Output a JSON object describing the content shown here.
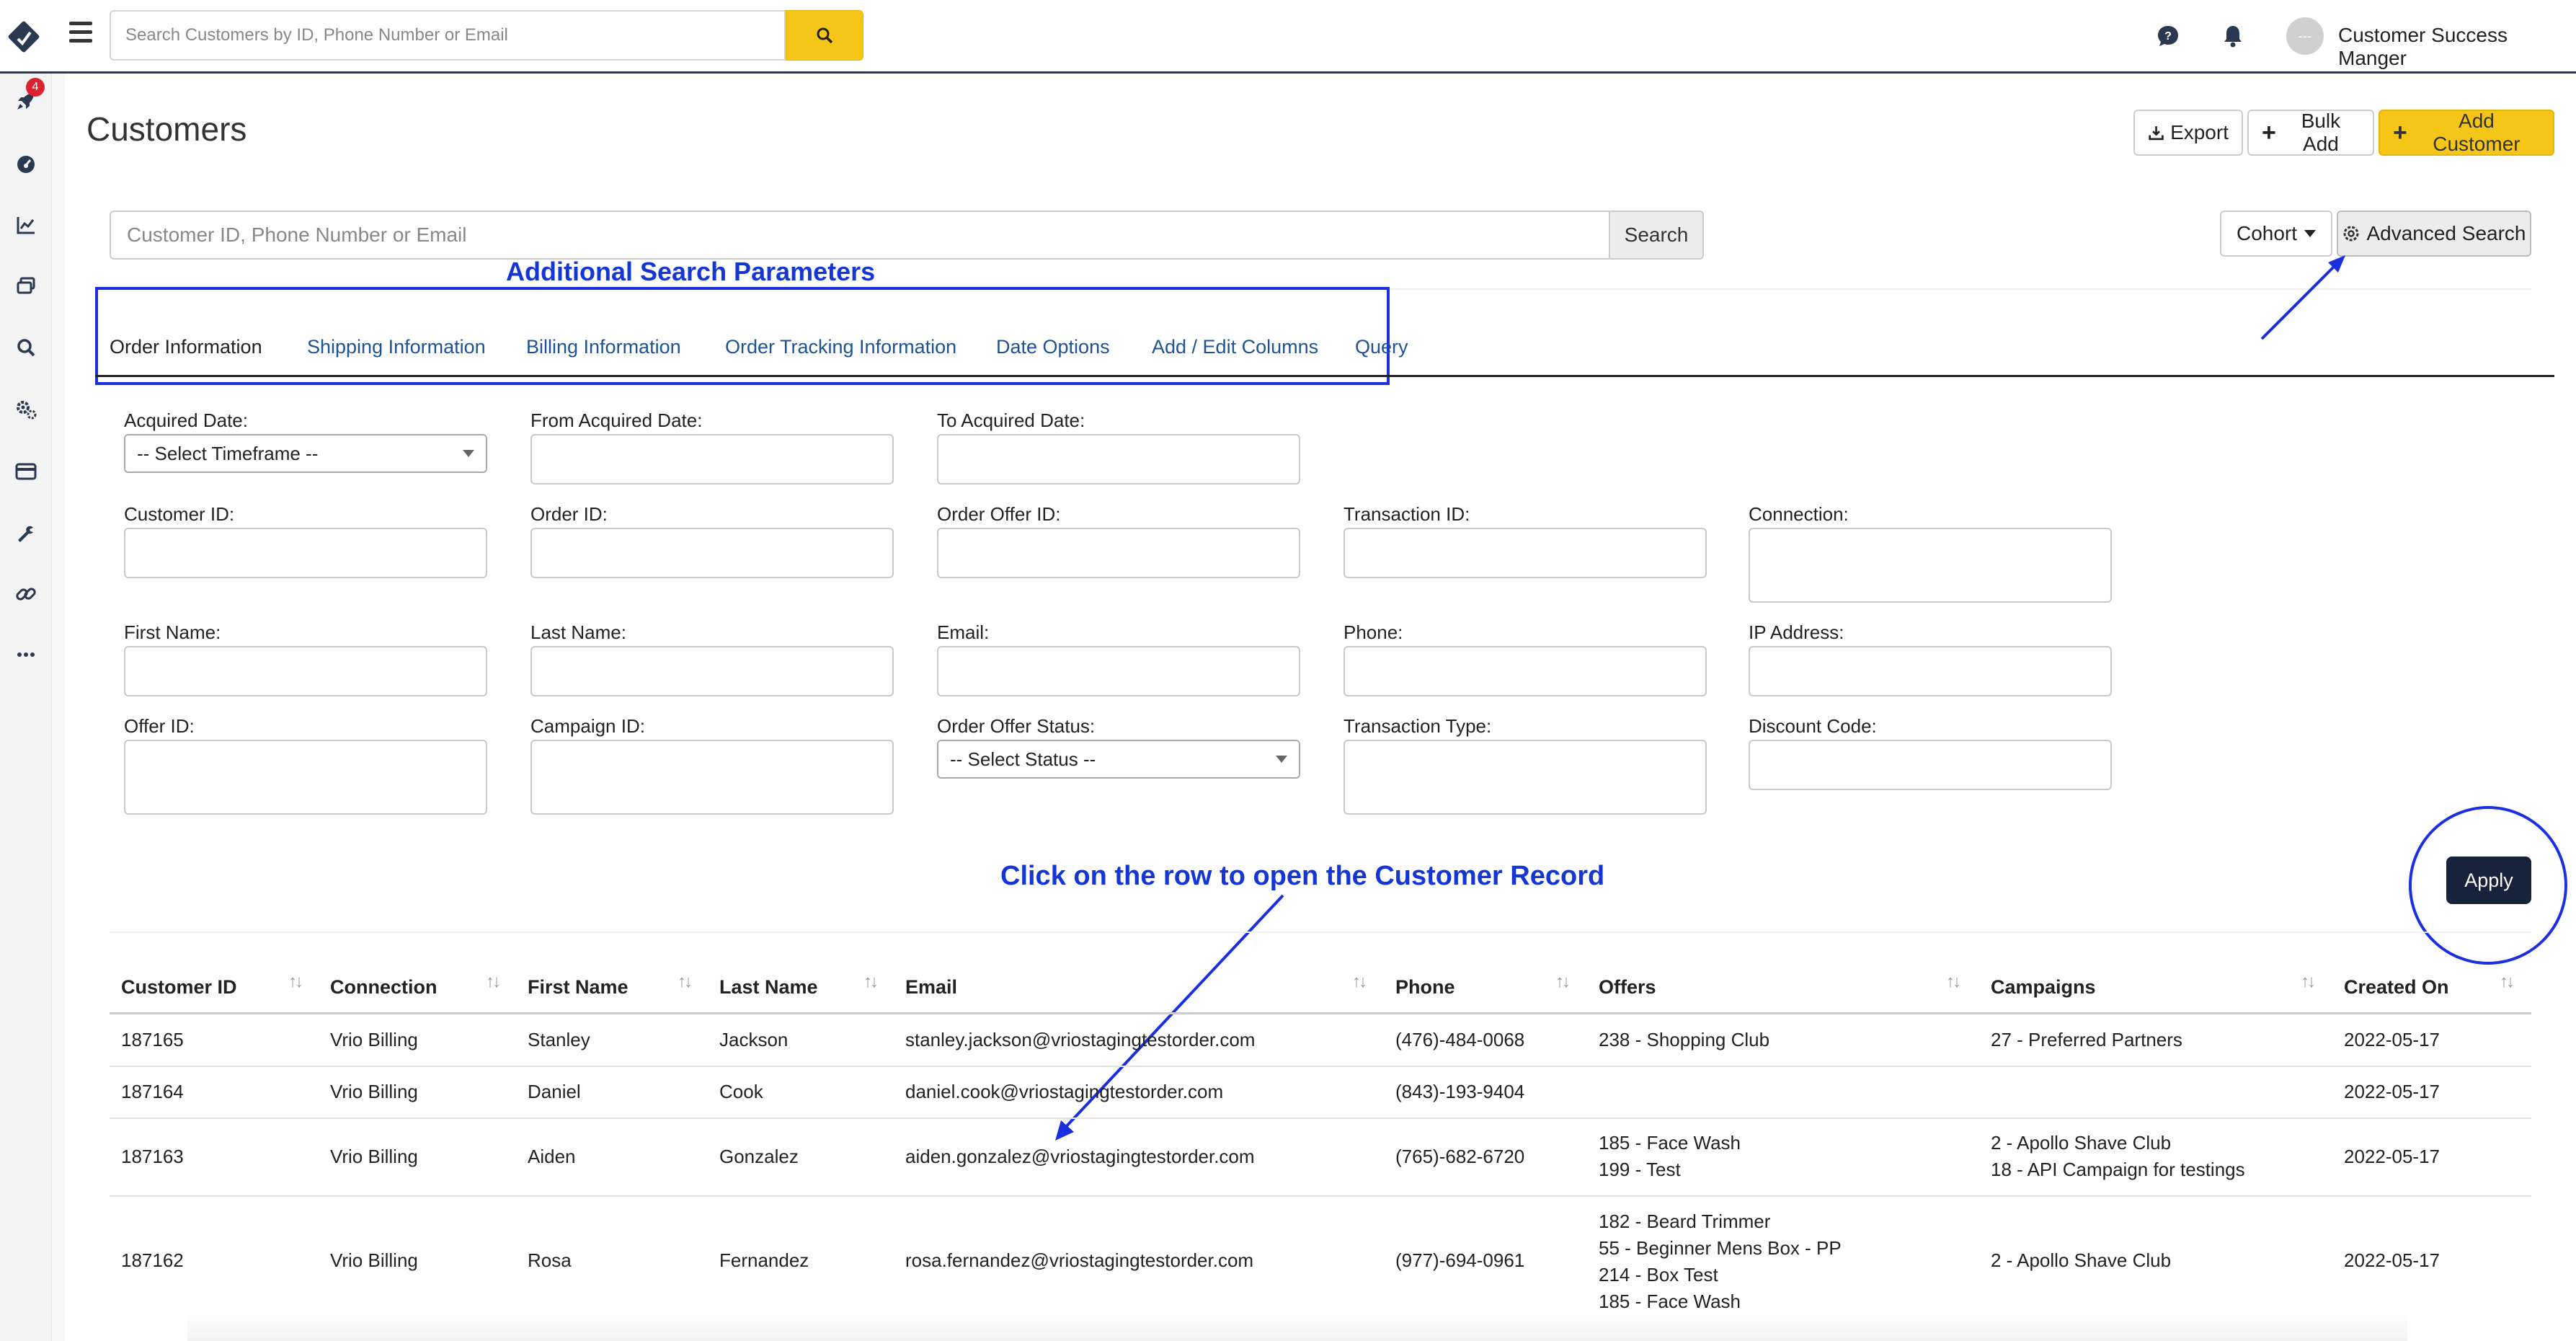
{
  "topbar": {
    "search_placeholder": "Search Customers by ID, Phone Number or Email",
    "user_initials": "---",
    "user_name": "Customer Success Manger"
  },
  "sidebar": {
    "notification_count": "4",
    "icons": [
      "rocket-icon",
      "dashboard-icon",
      "chart-icon",
      "documents-icon",
      "search-icon",
      "settings-icon",
      "billing-icon",
      "wrench-icon",
      "link-icon",
      "more-icon"
    ]
  },
  "page": {
    "title": "Customers",
    "export_label": "Export",
    "bulk_add_label": "Bulk Add",
    "add_customer_label": "Add Customer",
    "search_placeholder": "Customer ID, Phone Number or Email",
    "search_label": "Search",
    "cohort_label": "Cohort",
    "advanced_search_label": "Advanced Search"
  },
  "annotations": {
    "params": "Additional Search Parameters",
    "click_row": "Click on the row to open the Customer Record",
    "color": "#1b2ee0"
  },
  "tabs": [
    {
      "label": "Order Information"
    },
    {
      "label": "Shipping Information"
    },
    {
      "label": "Billing Information"
    },
    {
      "label": "Order Tracking Information"
    },
    {
      "label": "Date Options"
    },
    {
      "label": "Add / Edit Columns"
    },
    {
      "label": "Query"
    }
  ],
  "form": {
    "acquired_date": "Acquired Date:",
    "acquired_date_value": "-- Select Timeframe --",
    "from_acquired_date": "From Acquired Date:",
    "to_acquired_date": "To Acquired Date:",
    "customer_id": "Customer ID:",
    "order_id": "Order ID:",
    "order_offer_id": "Order Offer ID:",
    "transaction_id": "Transaction ID:",
    "connection": "Connection:",
    "first_name": "First Name:",
    "last_name": "Last Name:",
    "email": "Email:",
    "phone": "Phone:",
    "ip_address": "IP Address:",
    "offer_id": "Offer ID:",
    "campaign_id": "Campaign ID:",
    "order_offer_status": "Order Offer Status:",
    "order_offer_status_value": "-- Select Status --",
    "transaction_type": "Transaction Type:",
    "discount_code": "Discount Code:",
    "apply_label": "Apply"
  },
  "table": {
    "headers": [
      "Customer ID",
      "Connection",
      "First Name",
      "Last Name",
      "Email",
      "Phone",
      "Offers",
      "Campaigns",
      "Created On"
    ],
    "rows": [
      {
        "id": "187165",
        "connection": "Vrio Billing",
        "first": "Stanley",
        "last": "Jackson",
        "email": "stanley.jackson@vriostagingtestorder.com",
        "phone": "(476)-484-0068",
        "offers": [
          "238 - Shopping Club"
        ],
        "campaigns": [
          "27 - Preferred Partners"
        ],
        "created": "2022-05-17"
      },
      {
        "id": "187164",
        "connection": "Vrio Billing",
        "first": "Daniel",
        "last": "Cook",
        "email": "daniel.cook@vriostagingtestorder.com",
        "phone": "(843)-193-9404",
        "offers": [],
        "campaigns": [],
        "created": "2022-05-17"
      },
      {
        "id": "187163",
        "connection": "Vrio Billing",
        "first": "Aiden",
        "last": "Gonzalez",
        "email": "aiden.gonzalez@vriostagingtestorder.com",
        "phone": "(765)-682-6720",
        "offers": [
          "185 - Face Wash",
          "199 - Test"
        ],
        "campaigns": [
          "2 - Apollo Shave Club",
          "18 - API Campaign for testings"
        ],
        "created": "2022-05-17"
      },
      {
        "id": "187162",
        "connection": "Vrio Billing",
        "first": "Rosa",
        "last": "Fernandez",
        "email": "rosa.fernandez@vriostagingtestorder.com",
        "phone": "(977)-694-0961",
        "offers": [
          "182 - Beard Trimmer",
          "55 - Beginner Mens Box - PP",
          "214 - Box Test",
          "185 - Face Wash"
        ],
        "campaigns": [
          "2 - Apollo Shave Club"
        ],
        "created": "2022-05-17"
      }
    ]
  }
}
